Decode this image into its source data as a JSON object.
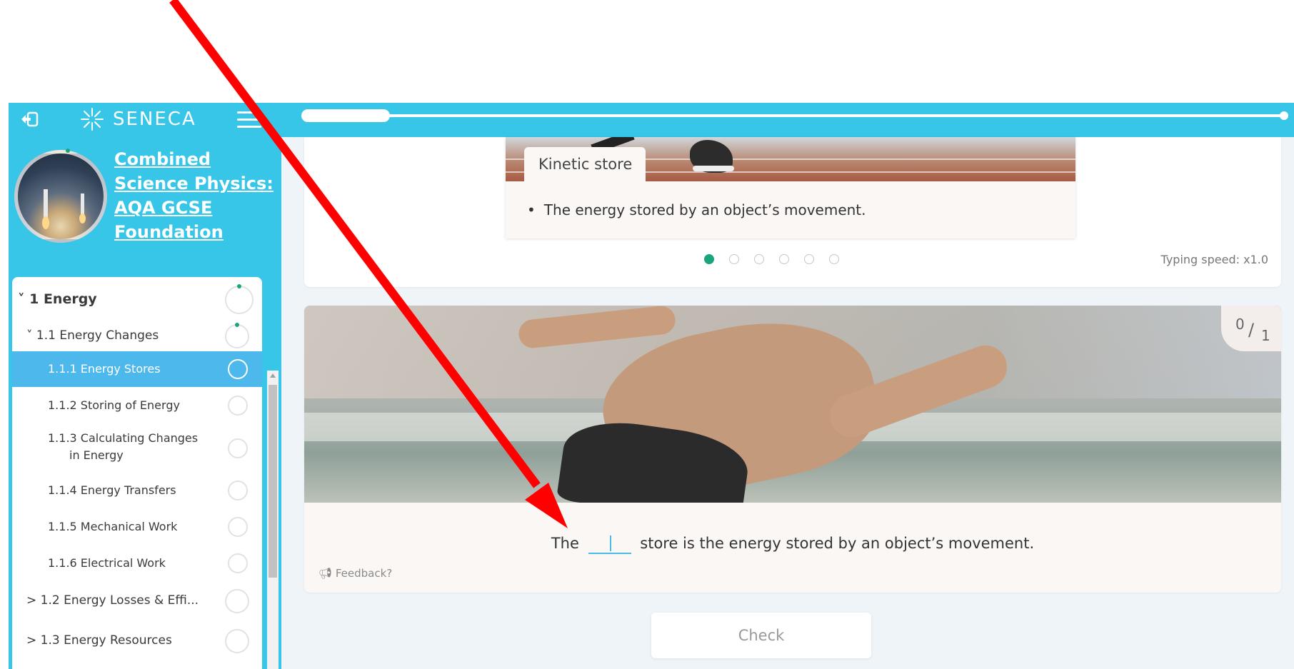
{
  "sidebar": {
    "brand": "SENECA",
    "course_title_lines": [
      "Combined",
      "Science Physics:",
      "AQA GCSE",
      "Foundation"
    ],
    "nav": [
      {
        "label": "˅ 1 Energy",
        "level": 0
      },
      {
        "label": "˅ 1.1 Energy Changes",
        "level": 1
      },
      {
        "label": "1.1.1 Energy Stores",
        "level": 2,
        "active": true
      },
      {
        "label": "1.1.2 Storing of Energy",
        "level": 2
      },
      {
        "label": "1.1.3 Calculating Changes",
        "label2": "in Energy",
        "level": 2
      },
      {
        "label": "1.1.4 Energy Transfers",
        "level": 2
      },
      {
        "label": "1.1.5 Mechanical Work",
        "level": 2
      },
      {
        "label": "1.1.6 Electrical Work",
        "level": 2
      },
      {
        "label": "> 1.2 Energy Losses & Effi...",
        "level": 1
      },
      {
        "label": "> 1.3 Energy Resources",
        "level": 1
      }
    ]
  },
  "progress": {
    "fraction": 0.09
  },
  "concept_card": {
    "tab": "Kinetic store",
    "bullet": "The energy stored by an object’s movement.",
    "dots_total": 6,
    "dots_active_index": 0,
    "typing_speed": "Typing speed: x1.0"
  },
  "question_card": {
    "score_num": "0",
    "score_den": "1",
    "sentence_before": "The",
    "sentence_after": "store is the energy stored by an object’s movement.",
    "feedback": "Feedback?"
  },
  "check_label": "Check",
  "colors": {
    "brand": "#37c6e8",
    "active_item": "#4db8ec",
    "green": "#1ba57f",
    "arrow": "#ff0000"
  }
}
